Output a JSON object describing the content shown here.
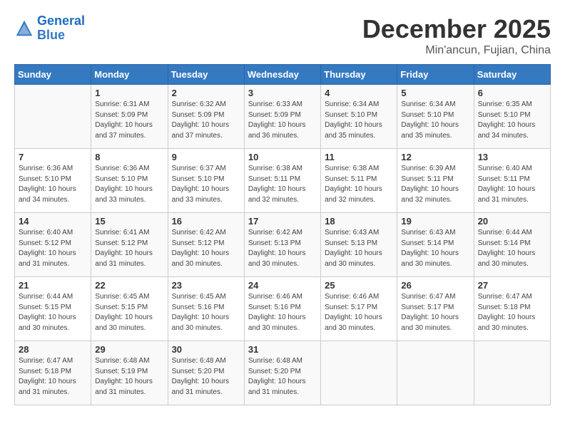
{
  "header": {
    "logo_line1": "General",
    "logo_line2": "Blue",
    "title": "December 2025",
    "subtitle": "Min'ancun, Fujian, China"
  },
  "weekdays": [
    "Sunday",
    "Monday",
    "Tuesday",
    "Wednesday",
    "Thursday",
    "Friday",
    "Saturday"
  ],
  "weeks": [
    [
      {
        "day": "",
        "sunrise": "",
        "sunset": "",
        "daylight": ""
      },
      {
        "day": "1",
        "sunrise": "Sunrise: 6:31 AM",
        "sunset": "Sunset: 5:09 PM",
        "daylight": "Daylight: 10 hours and 37 minutes."
      },
      {
        "day": "2",
        "sunrise": "Sunrise: 6:32 AM",
        "sunset": "Sunset: 5:09 PM",
        "daylight": "Daylight: 10 hours and 37 minutes."
      },
      {
        "day": "3",
        "sunrise": "Sunrise: 6:33 AM",
        "sunset": "Sunset: 5:09 PM",
        "daylight": "Daylight: 10 hours and 36 minutes."
      },
      {
        "day": "4",
        "sunrise": "Sunrise: 6:34 AM",
        "sunset": "Sunset: 5:10 PM",
        "daylight": "Daylight: 10 hours and 35 minutes."
      },
      {
        "day": "5",
        "sunrise": "Sunrise: 6:34 AM",
        "sunset": "Sunset: 5:10 PM",
        "daylight": "Daylight: 10 hours and 35 minutes."
      },
      {
        "day": "6",
        "sunrise": "Sunrise: 6:35 AM",
        "sunset": "Sunset: 5:10 PM",
        "daylight": "Daylight: 10 hours and 34 minutes."
      }
    ],
    [
      {
        "day": "7",
        "sunrise": "Sunrise: 6:36 AM",
        "sunset": "Sunset: 5:10 PM",
        "daylight": "Daylight: 10 hours and 34 minutes."
      },
      {
        "day": "8",
        "sunrise": "Sunrise: 6:36 AM",
        "sunset": "Sunset: 5:10 PM",
        "daylight": "Daylight: 10 hours and 33 minutes."
      },
      {
        "day": "9",
        "sunrise": "Sunrise: 6:37 AM",
        "sunset": "Sunset: 5:10 PM",
        "daylight": "Daylight: 10 hours and 33 minutes."
      },
      {
        "day": "10",
        "sunrise": "Sunrise: 6:38 AM",
        "sunset": "Sunset: 5:11 PM",
        "daylight": "Daylight: 10 hours and 32 minutes."
      },
      {
        "day": "11",
        "sunrise": "Sunrise: 6:38 AM",
        "sunset": "Sunset: 5:11 PM",
        "daylight": "Daylight: 10 hours and 32 minutes."
      },
      {
        "day": "12",
        "sunrise": "Sunrise: 6:39 AM",
        "sunset": "Sunset: 5:11 PM",
        "daylight": "Daylight: 10 hours and 32 minutes."
      },
      {
        "day": "13",
        "sunrise": "Sunrise: 6:40 AM",
        "sunset": "Sunset: 5:11 PM",
        "daylight": "Daylight: 10 hours and 31 minutes."
      }
    ],
    [
      {
        "day": "14",
        "sunrise": "Sunrise: 6:40 AM",
        "sunset": "Sunset: 5:12 PM",
        "daylight": "Daylight: 10 hours and 31 minutes."
      },
      {
        "day": "15",
        "sunrise": "Sunrise: 6:41 AM",
        "sunset": "Sunset: 5:12 PM",
        "daylight": "Daylight: 10 hours and 31 minutes."
      },
      {
        "day": "16",
        "sunrise": "Sunrise: 6:42 AM",
        "sunset": "Sunset: 5:12 PM",
        "daylight": "Daylight: 10 hours and 30 minutes."
      },
      {
        "day": "17",
        "sunrise": "Sunrise: 6:42 AM",
        "sunset": "Sunset: 5:13 PM",
        "daylight": "Daylight: 10 hours and 30 minutes."
      },
      {
        "day": "18",
        "sunrise": "Sunrise: 6:43 AM",
        "sunset": "Sunset: 5:13 PM",
        "daylight": "Daylight: 10 hours and 30 minutes."
      },
      {
        "day": "19",
        "sunrise": "Sunrise: 6:43 AM",
        "sunset": "Sunset: 5:14 PM",
        "daylight": "Daylight: 10 hours and 30 minutes."
      },
      {
        "day": "20",
        "sunrise": "Sunrise: 6:44 AM",
        "sunset": "Sunset: 5:14 PM",
        "daylight": "Daylight: 10 hours and 30 minutes."
      }
    ],
    [
      {
        "day": "21",
        "sunrise": "Sunrise: 6:44 AM",
        "sunset": "Sunset: 5:15 PM",
        "daylight": "Daylight: 10 hours and 30 minutes."
      },
      {
        "day": "22",
        "sunrise": "Sunrise: 6:45 AM",
        "sunset": "Sunset: 5:15 PM",
        "daylight": "Daylight: 10 hours and 30 minutes."
      },
      {
        "day": "23",
        "sunrise": "Sunrise: 6:45 AM",
        "sunset": "Sunset: 5:16 PM",
        "daylight": "Daylight: 10 hours and 30 minutes."
      },
      {
        "day": "24",
        "sunrise": "Sunrise: 6:46 AM",
        "sunset": "Sunset: 5:16 PM",
        "daylight": "Daylight: 10 hours and 30 minutes."
      },
      {
        "day": "25",
        "sunrise": "Sunrise: 6:46 AM",
        "sunset": "Sunset: 5:17 PM",
        "daylight": "Daylight: 10 hours and 30 minutes."
      },
      {
        "day": "26",
        "sunrise": "Sunrise: 6:47 AM",
        "sunset": "Sunset: 5:17 PM",
        "daylight": "Daylight: 10 hours and 30 minutes."
      },
      {
        "day": "27",
        "sunrise": "Sunrise: 6:47 AM",
        "sunset": "Sunset: 5:18 PM",
        "daylight": "Daylight: 10 hours and 30 minutes."
      }
    ],
    [
      {
        "day": "28",
        "sunrise": "Sunrise: 6:47 AM",
        "sunset": "Sunset: 5:18 PM",
        "daylight": "Daylight: 10 hours and 31 minutes."
      },
      {
        "day": "29",
        "sunrise": "Sunrise: 6:48 AM",
        "sunset": "Sunset: 5:19 PM",
        "daylight": "Daylight: 10 hours and 31 minutes."
      },
      {
        "day": "30",
        "sunrise": "Sunrise: 6:48 AM",
        "sunset": "Sunset: 5:20 PM",
        "daylight": "Daylight: 10 hours and 31 minutes."
      },
      {
        "day": "31",
        "sunrise": "Sunrise: 6:48 AM",
        "sunset": "Sunset: 5:20 PM",
        "daylight": "Daylight: 10 hours and 31 minutes."
      },
      {
        "day": "",
        "sunrise": "",
        "sunset": "",
        "daylight": ""
      },
      {
        "day": "",
        "sunrise": "",
        "sunset": "",
        "daylight": ""
      },
      {
        "day": "",
        "sunrise": "",
        "sunset": "",
        "daylight": ""
      }
    ]
  ]
}
